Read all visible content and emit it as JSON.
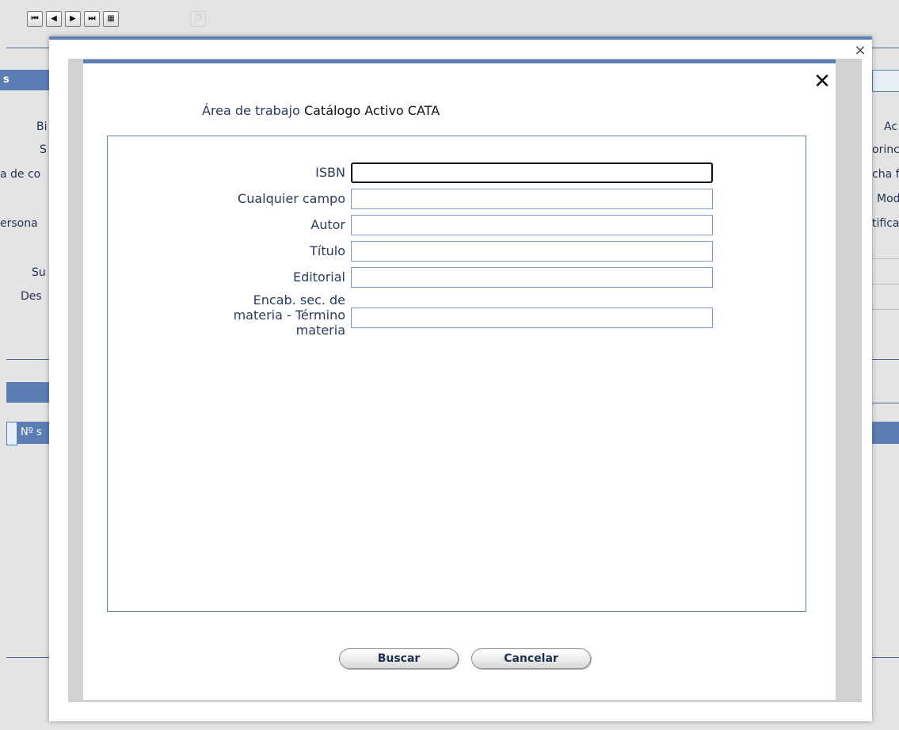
{
  "toolbar": {
    "first_icon": "first-record-icon",
    "prev_icon": "previous-record-icon",
    "next_icon": "next-record-icon",
    "last_icon": "last-record-icon",
    "grid_icon": "grid-view-icon",
    "copy_icon": "copy-icon",
    "first_glyph": "⏮",
    "prev_glyph": "◀",
    "next_glyph": "▶",
    "last_glyph": "⏭",
    "grid_glyph": "▦",
    "copy_glyph": "❐"
  },
  "background": {
    "left_header": "s",
    "left_fragments": [
      "Bi",
      "S",
      "a de co",
      "ersona",
      "Su",
      "Des"
    ],
    "right_fragments": [
      "Ac",
      "orinc",
      "cha f",
      "Mod",
      "tifica"
    ],
    "table_header": "Nº s"
  },
  "outer_modal": {
    "close_label": "×"
  },
  "inner_modal": {
    "close_label": "✕",
    "workarea_label": "Área de trabajo",
    "workarea_value": "Catálogo Activo CATA"
  },
  "form": {
    "fields": [
      {
        "label": "ISBN",
        "value": ""
      },
      {
        "label": "Cualquier campo",
        "value": ""
      },
      {
        "label": "Autor",
        "value": ""
      },
      {
        "label": "Título",
        "value": ""
      },
      {
        "label": "Editorial",
        "value": ""
      },
      {
        "label_lines": [
          "Encab. sec. de",
          "materia - Término",
          "materia"
        ],
        "value": ""
      }
    ]
  },
  "buttons": {
    "search": "Buscar",
    "cancel": "Cancelar"
  },
  "colors": {
    "accent": "#5b7fb5",
    "label": "#2b3b5a",
    "panel_border": "#5b7fb5"
  }
}
